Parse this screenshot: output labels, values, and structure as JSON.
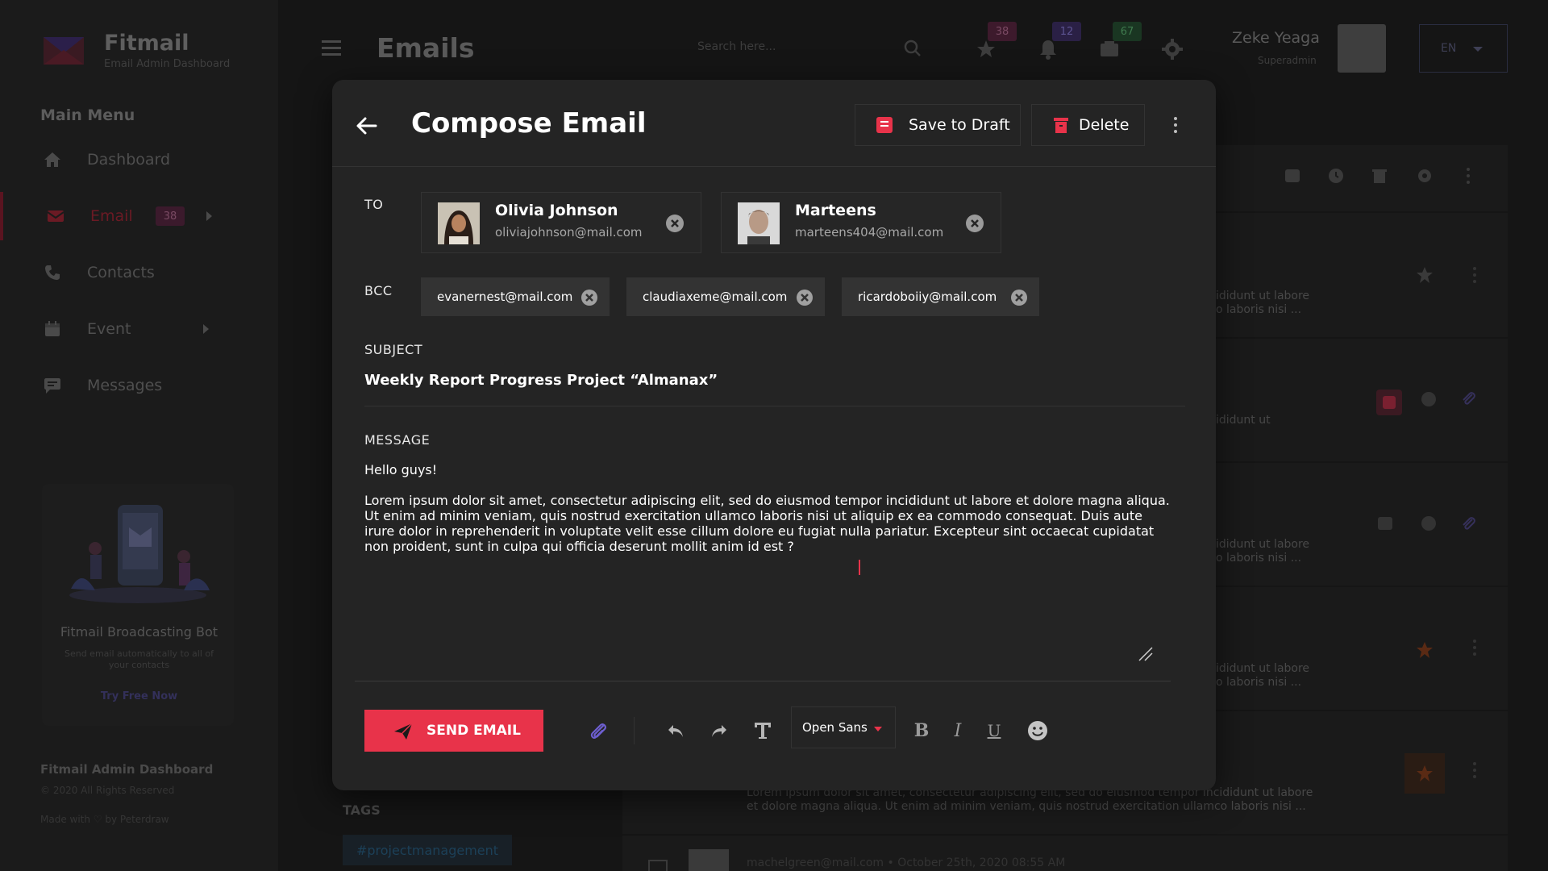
{
  "app": {
    "brand": "Fitmail",
    "brand_sub": "Email Admin Dashboard",
    "menu_title": "Main Menu",
    "menu": [
      {
        "label": "Dashboard",
        "icon": "home-icon"
      },
      {
        "label": "Email",
        "icon": "envelope-icon",
        "badge": "38",
        "active": true
      },
      {
        "label": "Contacts",
        "icon": "phone-icon"
      },
      {
        "label": "Event",
        "icon": "calendar-icon"
      },
      {
        "label": "Messages",
        "icon": "chat-icon"
      }
    ],
    "promo": {
      "title": "Fitmail Broadcasting Bot",
      "subtitle": "Send email automatically to all of your contacts",
      "link": "Try Free Now"
    },
    "footer": {
      "title": "Fitmail Admin Dashboard",
      "copyright": "© 2020 All Rights Reserved",
      "made": "Made with ♡ by Peterdraw"
    }
  },
  "header": {
    "title": "Emails",
    "search_placeholder": "Search here...",
    "badges": {
      "star": "38",
      "bell": "12",
      "inbox": "67"
    },
    "user_name": "Zeke Yeaga",
    "user_role": "Superadmin",
    "lang": "EN"
  },
  "background": {
    "tags_title": "TAGS",
    "tag": "#projectmanagement",
    "snippet_a": "ididunt ut labore\no laboris nisi ...",
    "snippet_b": "ididunt ut",
    "long_snippet": "Lorem ipsum dolor sit amet, consectetur adipiscing elit, sed do eiusmod tempor incididunt ut labore et dolore magna aliqua. Ut enim ad minim veniam, quis nostrud exercitation ullamco laboris nisi ...",
    "row_meta": "machelgreen@mail.com •   October 25th, 2020  08:55 AM"
  },
  "compose": {
    "title": "Compose Email",
    "save_draft": "Save to Draft",
    "delete": "Delete",
    "to_label": "TO",
    "to": [
      {
        "name": "Olivia Johnson",
        "email": "oliviajohnson@mail.com"
      },
      {
        "name": "Marteens",
        "email": "marteens404@mail.com"
      }
    ],
    "bcc_label": "BCC",
    "bcc": [
      "evanernest@mail.com",
      "claudiaxeme@mail.com",
      "ricardoboiiy@mail.com"
    ],
    "subject_label": "SUBJECT",
    "subject": "Weekly Report Progress Project “Almanax”",
    "message_label": "MESSAGE",
    "greeting": "Hello guys!",
    "body": "Lorem ipsum dolor sit amet, consectetur adipiscing elit, sed do eiusmod tempor incididunt ut labore et dolore magna aliqua. Ut enim ad minim veniam, quis nostrud exercitation ullamco laboris nisi ut aliquip ex ea commodo consequat. Duis aute irure dolor in reprehenderit in voluptate velit esse cillum dolore eu fugiat nulla pariatur. Excepteur sint occaecat cupidatat non proident, sunt in culpa qui officia deserunt mollit anim id est ?",
    "send": "SEND EMAIL",
    "font": "Open Sans"
  },
  "colors": {
    "accent": "#e8334a",
    "bg": "#151515",
    "modal": "#242424"
  }
}
